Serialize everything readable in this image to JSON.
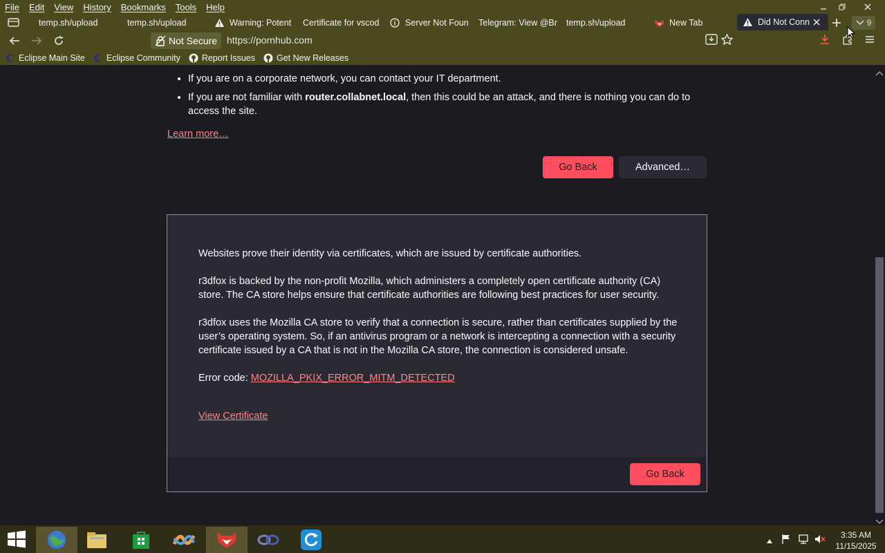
{
  "menu": [
    "File",
    "Edit",
    "View",
    "History",
    "Bookmarks",
    "Tools",
    "Help"
  ],
  "tabs": [
    {
      "label": "temp.sh/upload",
      "icon": "none"
    },
    {
      "label": "temp.sh/upload",
      "icon": "none"
    },
    {
      "label": "Warning: Potent",
      "icon": "warning-icon"
    },
    {
      "label": "Certificate for vscod",
      "icon": "none"
    },
    {
      "label": "Server Not Foun",
      "icon": "info-icon"
    },
    {
      "label": "Telegram: View @Br",
      "icon": "none"
    },
    {
      "label": "temp.sh/upload",
      "icon": "none"
    },
    {
      "label": "New Tab",
      "icon": "fox-icon"
    },
    {
      "label": "Did Not Conn",
      "icon": "warning-icon"
    }
  ],
  "tab_count": "9",
  "urlbar": {
    "security_label": "Not Secure",
    "url": "https://pornhub.com"
  },
  "bookmarks": [
    {
      "label": "Eclipse Main Site",
      "icon": "eclipse-icon"
    },
    {
      "label": "Eclipse Community",
      "icon": "eclipse-icon"
    },
    {
      "label": "Report Issues",
      "icon": "github-icon"
    },
    {
      "label": "Get New Releases",
      "icon": "github-icon"
    }
  ],
  "content": {
    "bullet1": "If you are on a corporate network, you can contact your IT department.",
    "bullet2_pre": "If you are not familiar with ",
    "bullet2_bold": "router.collabnet.local",
    "bullet2_post": ", then this could be an attack, and there is nothing you can do to access the site.",
    "learn_more": "Learn more…",
    "go_back": "Go Back",
    "advanced": "Advanced…",
    "adv_p1": "Websites prove their identity via certificates, which are issued by certificate authorities.",
    "adv_p2": "r3dfox is backed by the non-profit Mozilla, which administers a completely open certificate authority (CA) store. The CA store helps ensure that certificate authorities are following best practices for user security.",
    "adv_p3": "r3dfox uses the Mozilla CA store to verify that a connection is secure, rather than certificates supplied by the user’s operating system. So, if an antivirus program or a network is intercepting a connection with a security certificate issued by a CA that is not in the Mozilla CA store, the connection is considered unsafe.",
    "error_label": "Error code: ",
    "error_code": "MOZILLA_PKIX_ERROR_MITM_DETECTED",
    "view_cert": "View Certificate",
    "go_back_2": "Go Back"
  },
  "taskbar": {
    "time": "3:35 AM",
    "date": "11/15/2025"
  },
  "colors": {
    "chrome": "#4a4a1e",
    "content_bg": "#1c1b22",
    "panel_bg": "#2b2a33",
    "accent_red": "#ff4f5e",
    "link": "#ff848b"
  }
}
